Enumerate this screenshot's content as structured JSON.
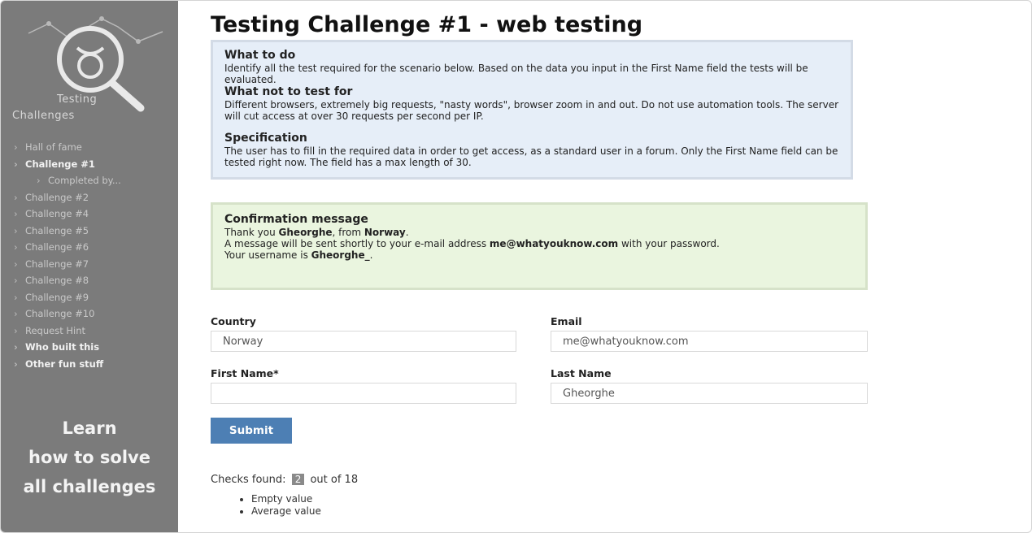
{
  "sidebar": {
    "logo": {
      "text_line1": "Testing",
      "text_line2": "Challenges"
    },
    "items": [
      {
        "label": "Hall of fame",
        "bright": false,
        "sub": false
      },
      {
        "label": "Challenge #1",
        "bright": true,
        "sub": false
      },
      {
        "label": "Completed by...",
        "bright": false,
        "sub": true
      },
      {
        "label": "Challenge #2",
        "bright": false,
        "sub": false
      },
      {
        "label": "Challenge #4",
        "bright": false,
        "sub": false
      },
      {
        "label": "Challenge #5",
        "bright": false,
        "sub": false
      },
      {
        "label": "Challenge #6",
        "bright": false,
        "sub": false
      },
      {
        "label": "Challenge #7",
        "bright": false,
        "sub": false
      },
      {
        "label": "Challenge #8",
        "bright": false,
        "sub": false
      },
      {
        "label": "Challenge #9",
        "bright": false,
        "sub": false
      },
      {
        "label": "Challenge #10",
        "bright": false,
        "sub": false
      },
      {
        "label": "Request Hint",
        "bright": false,
        "sub": false
      },
      {
        "label": "Who built this",
        "bright": true,
        "sub": false
      },
      {
        "label": "Other fun stuff",
        "bright": true,
        "sub": false
      }
    ],
    "learn_lines": [
      "Learn",
      "how to solve",
      "all challenges"
    ]
  },
  "main": {
    "title": "Testing Challenge #1 - web testing",
    "info": {
      "what_to_do_h": "What to do",
      "what_to_do_p": "Identify all the test required for the scenario below. Based on the data you input in the First Name field the tests will be evaluated.",
      "what_not_h": "What not to test for",
      "what_not_p": "Different browsers, extremely big requests, \"nasty words\", browser zoom in and out. Do not use automation tools. The server will cut access at over 30 requests per second per IP.",
      "spec_h": "Specification",
      "spec_p": "The user has to fill in the required data in order to get access, as a standard user in a forum. Only the First Name field can be tested right now. The field has a max length of 30."
    },
    "confirm": {
      "h": "Confirmation message",
      "line1_pre": "Thank you ",
      "line1_name": "Gheorghe",
      "line1_mid": ", from ",
      "line1_country": "Norway",
      "line1_end": ".",
      "line2_pre": "A message will be sent shortly to your e-mail address ",
      "line2_email": "me@whatyouknow.com",
      "line2_end": " with your password.",
      "line3_pre": "Your username is ",
      "line3_user": "Gheorghe_",
      "line3_end": "."
    },
    "form": {
      "country_label": "Country",
      "country_value": "Norway",
      "email_label": "Email",
      "email_value": "me@whatyouknow.com",
      "first_name_label": "First Name*",
      "first_name_value": "",
      "last_name_label": "Last Name",
      "last_name_value": "Gheorghe",
      "submit_label": "Submit"
    },
    "checks": {
      "prefix": "Checks found:",
      "count": "2",
      "suffix": "out of 18",
      "items": [
        "Empty value",
        "Average value"
      ]
    }
  },
  "colors": {
    "sidebar_bg": "#7b7b7b",
    "info_bg": "#e6eef8",
    "confirm_bg": "#eaf5df",
    "submit_bg": "#4d7fb4"
  },
  "icons": {
    "logo": "magnifier-taurus-logo-icon",
    "nav_marker": "chevron-right-icon"
  }
}
